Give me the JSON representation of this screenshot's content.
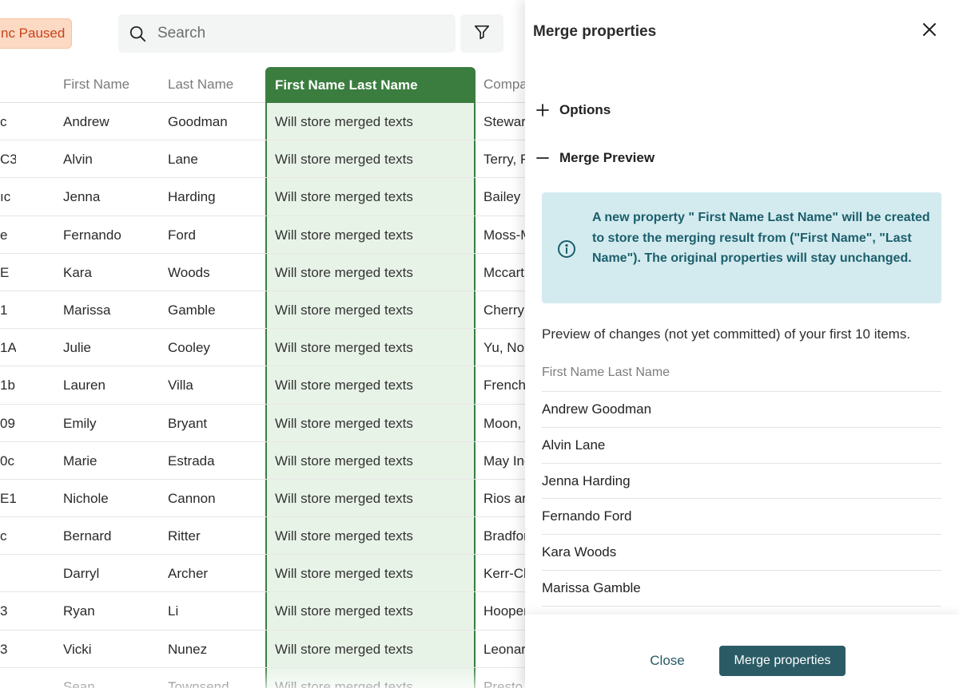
{
  "toolbar": {
    "sync_badge": "nc Paused",
    "search_placeholder": "Search"
  },
  "table": {
    "columns": [
      "First Name",
      "Last Name",
      "First Name Last Name",
      "Compa"
    ],
    "rows": [
      {
        "id": "c",
        "first": "Andrew",
        "last": "Goodman",
        "merged": "Will store merged texts",
        "company": "Stewar"
      },
      {
        "id": "C3",
        "first": "Alvin",
        "last": "Lane",
        "merged": "Will store merged texts",
        "company": "Terry, F"
      },
      {
        "id": "ıc",
        "first": "Jenna",
        "last": "Harding",
        "merged": "Will store merged texts",
        "company": "Bailey ("
      },
      {
        "id": "e",
        "first": "Fernando",
        "last": "Ford",
        "merged": "Will store merged texts",
        "company": "Moss-M"
      },
      {
        "id": "E",
        "first": "Kara",
        "last": "Woods",
        "merged": "Will store merged texts",
        "company": "Mccart"
      },
      {
        "id": "1",
        "first": "Marissa",
        "last": "Gamble",
        "merged": "Will store merged texts",
        "company": "Cherry"
      },
      {
        "id": "1A",
        "first": "Julie",
        "last": "Cooley",
        "merged": "Will store merged texts",
        "company": "Yu, Nor"
      },
      {
        "id": "1b",
        "first": "Lauren",
        "last": "Villa",
        "merged": "Will store merged texts",
        "company": "French,"
      },
      {
        "id": "09",
        "first": "Emily",
        "last": "Bryant",
        "merged": "Will store merged texts",
        "company": "Moon, ."
      },
      {
        "id": "0c",
        "first": "Marie",
        "last": "Estrada",
        "merged": "Will store merged texts",
        "company": "May Inc"
      },
      {
        "id": "E1",
        "first": "Nichole",
        "last": "Cannon",
        "merged": "Will store merged texts",
        "company": "Rios ar"
      },
      {
        "id": "c",
        "first": "Bernard",
        "last": "Ritter",
        "merged": "Will store merged texts",
        "company": "Bradfor"
      },
      {
        "id": "",
        "first": "Darryl",
        "last": "Archer",
        "merged": "Will store merged texts",
        "company": "Kerr-Ch"
      },
      {
        "id": "3",
        "first": "Ryan",
        "last": "Li",
        "merged": "Will store merged texts",
        "company": "Hooper"
      },
      {
        "id": "3",
        "first": "Vicki",
        "last": "Nunez",
        "merged": "Will store merged texts",
        "company": "Leonar"
      },
      {
        "id": "",
        "first": "Sean",
        "last": "Townsend",
        "merged": "Will store merged texts",
        "company": "Presto"
      }
    ]
  },
  "panel": {
    "title": "Merge properties",
    "options_label": "Options",
    "merge_preview_label": "Merge Preview",
    "info_text": "A new property \" First Name Last Name\" will be created to store the merging result from  (\"First Name\", \"Last Name\"). The original properties will stay unchanged.",
    "preview_note": "Preview of changes (not yet committed) of your first 10 items.",
    "preview_header": "First Name Last Name",
    "preview_rows": [
      "Andrew Goodman",
      "Alvin Lane",
      "Jenna Harding",
      "Fernando Ford",
      "Kara Woods",
      "Marissa Gamble"
    ],
    "close_label": "Close",
    "merge_label": "Merge properties"
  },
  "colors": {
    "merged_header": "#3a7d3f",
    "merged_column_bg": "#e8f3e8",
    "info_bg": "#d3ebef",
    "info_text": "#1c5e6b",
    "primary_button": "#2b5c66",
    "sync_badge_bg": "#fbd9c3",
    "sync_badge_text": "#c8431a"
  }
}
